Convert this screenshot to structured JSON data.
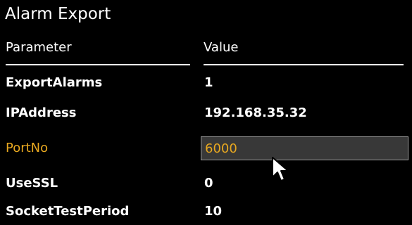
{
  "window": {
    "title": "Alarm Export"
  },
  "table": {
    "headers": {
      "parameter": "Parameter",
      "value": "Value"
    },
    "rows": [
      {
        "name": "ExportAlarms",
        "value": "1"
      },
      {
        "name": "IPAddress",
        "value": "192.168.35.32"
      },
      {
        "name": "PortNo",
        "value": "6000"
      },
      {
        "name": "UseSSL",
        "value": "0"
      },
      {
        "name": "SocketTestPeriod",
        "value": "10"
      }
    ]
  },
  "colors": {
    "background": "#000000",
    "text": "#ffffff",
    "active_label": "#e8a820",
    "input_background": "#383838",
    "input_border": "#9a9a9a"
  },
  "icons": {
    "pointer": "mouse-pointer-icon"
  }
}
